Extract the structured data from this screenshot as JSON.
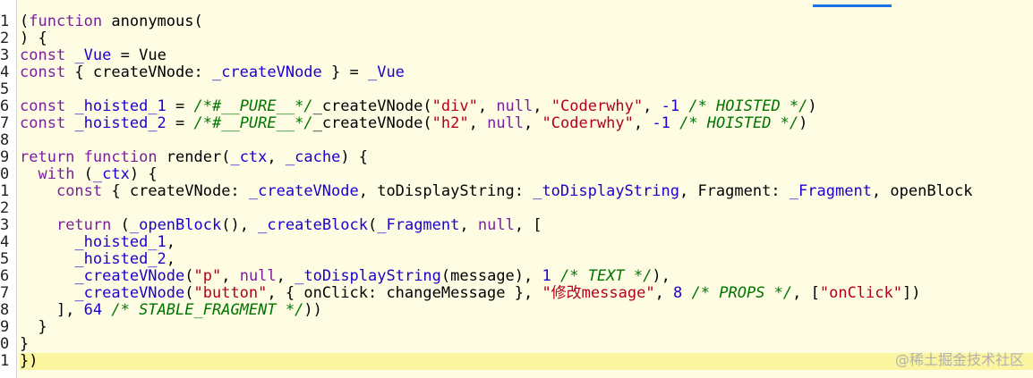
{
  "gutter_numbers": [
    "1",
    "2",
    "3",
    "4",
    "5",
    "6",
    "7",
    "8",
    "9",
    "0",
    "1",
    "2",
    "3",
    "4",
    "5",
    "6",
    "7",
    "8",
    "9",
    "0",
    "1"
  ],
  "code_lines": [
    [
      {
        "t": "(",
        "c": "plain"
      },
      {
        "t": "function",
        "c": "kw"
      },
      {
        "t": " anonymous(",
        "c": "plain"
      }
    ],
    [
      {
        "t": ") {",
        "c": "plain"
      }
    ],
    [
      {
        "t": "const",
        "c": "kw"
      },
      {
        "t": " ",
        "c": "plain"
      },
      {
        "t": "_Vue",
        "c": "var"
      },
      {
        "t": " = Vue",
        "c": "plain"
      }
    ],
    [
      {
        "t": "const",
        "c": "kw"
      },
      {
        "t": " { createVNode: ",
        "c": "plain"
      },
      {
        "t": "_createVNode",
        "c": "var"
      },
      {
        "t": " } = ",
        "c": "plain"
      },
      {
        "t": "_Vue",
        "c": "var"
      }
    ],
    [],
    [
      {
        "t": "const",
        "c": "kw"
      },
      {
        "t": " ",
        "c": "plain"
      },
      {
        "t": "_hoisted_1",
        "c": "var"
      },
      {
        "t": " = ",
        "c": "plain"
      },
      {
        "t": "/*#__PURE__*/",
        "c": "comment"
      },
      {
        "t": "_createVNode(",
        "c": "plain"
      },
      {
        "t": "\"div\"",
        "c": "str"
      },
      {
        "t": ", ",
        "c": "plain"
      },
      {
        "t": "null",
        "c": "kw"
      },
      {
        "t": ", ",
        "c": "plain"
      },
      {
        "t": "\"Coderwhy\"",
        "c": "str"
      },
      {
        "t": ", ",
        "c": "plain"
      },
      {
        "t": "-1",
        "c": "num"
      },
      {
        "t": " ",
        "c": "plain"
      },
      {
        "t": "/* HOISTED */",
        "c": "comment"
      },
      {
        "t": ")",
        "c": "plain"
      }
    ],
    [
      {
        "t": "const",
        "c": "kw"
      },
      {
        "t": " ",
        "c": "plain"
      },
      {
        "t": "_hoisted_2",
        "c": "var"
      },
      {
        "t": " = ",
        "c": "plain"
      },
      {
        "t": "/*#__PURE__*/",
        "c": "comment"
      },
      {
        "t": "_createVNode(",
        "c": "plain"
      },
      {
        "t": "\"h2\"",
        "c": "str"
      },
      {
        "t": ", ",
        "c": "plain"
      },
      {
        "t": "null",
        "c": "kw"
      },
      {
        "t": ", ",
        "c": "plain"
      },
      {
        "t": "\"Coderwhy\"",
        "c": "str"
      },
      {
        "t": ", ",
        "c": "plain"
      },
      {
        "t": "-1",
        "c": "num"
      },
      {
        "t": " ",
        "c": "plain"
      },
      {
        "t": "/* HOISTED */",
        "c": "comment"
      },
      {
        "t": ")",
        "c": "plain"
      }
    ],
    [],
    [
      {
        "t": "return",
        "c": "kw"
      },
      {
        "t": " ",
        "c": "plain"
      },
      {
        "t": "function",
        "c": "kw"
      },
      {
        "t": " render(",
        "c": "plain"
      },
      {
        "t": "_ctx",
        "c": "var"
      },
      {
        "t": ", ",
        "c": "plain"
      },
      {
        "t": "_cache",
        "c": "var"
      },
      {
        "t": ") {",
        "c": "plain"
      }
    ],
    [
      {
        "t": "  ",
        "c": "plain"
      },
      {
        "t": "with",
        "c": "kw"
      },
      {
        "t": " (",
        "c": "plain"
      },
      {
        "t": "_ctx",
        "c": "var"
      },
      {
        "t": ") {",
        "c": "plain"
      }
    ],
    [
      {
        "t": "    ",
        "c": "plain"
      },
      {
        "t": "const",
        "c": "kw"
      },
      {
        "t": " { createVNode: ",
        "c": "plain"
      },
      {
        "t": "_createVNode",
        "c": "var"
      },
      {
        "t": ", toDisplayString: ",
        "c": "plain"
      },
      {
        "t": "_toDisplayString",
        "c": "var"
      },
      {
        "t": ", Fragment: ",
        "c": "plain"
      },
      {
        "t": "_Fragment",
        "c": "var"
      },
      {
        "t": ", openBlock",
        "c": "plain"
      }
    ],
    [],
    [
      {
        "t": "    ",
        "c": "plain"
      },
      {
        "t": "return",
        "c": "kw"
      },
      {
        "t": " (",
        "c": "plain"
      },
      {
        "t": "_openBlock",
        "c": "var"
      },
      {
        "t": "(), ",
        "c": "plain"
      },
      {
        "t": "_createBlock",
        "c": "var"
      },
      {
        "t": "(",
        "c": "plain"
      },
      {
        "t": "_Fragment",
        "c": "var"
      },
      {
        "t": ", ",
        "c": "plain"
      },
      {
        "t": "null",
        "c": "kw"
      },
      {
        "t": ", [",
        "c": "plain"
      }
    ],
    [
      {
        "t": "      ",
        "c": "plain"
      },
      {
        "t": "_hoisted_1",
        "c": "var"
      },
      {
        "t": ",",
        "c": "plain"
      }
    ],
    [
      {
        "t": "      ",
        "c": "plain"
      },
      {
        "t": "_hoisted_2",
        "c": "var"
      },
      {
        "t": ",",
        "c": "plain"
      }
    ],
    [
      {
        "t": "      ",
        "c": "plain"
      },
      {
        "t": "_createVNode",
        "c": "var"
      },
      {
        "t": "(",
        "c": "plain"
      },
      {
        "t": "\"p\"",
        "c": "str"
      },
      {
        "t": ", ",
        "c": "plain"
      },
      {
        "t": "null",
        "c": "kw"
      },
      {
        "t": ", ",
        "c": "plain"
      },
      {
        "t": "_toDisplayString",
        "c": "var"
      },
      {
        "t": "(message), ",
        "c": "plain"
      },
      {
        "t": "1",
        "c": "num"
      },
      {
        "t": " ",
        "c": "plain"
      },
      {
        "t": "/* TEXT */",
        "c": "comment"
      },
      {
        "t": "),",
        "c": "plain"
      }
    ],
    [
      {
        "t": "      ",
        "c": "plain"
      },
      {
        "t": "_createVNode",
        "c": "var"
      },
      {
        "t": "(",
        "c": "plain"
      },
      {
        "t": "\"button\"",
        "c": "str"
      },
      {
        "t": ", { onClick: changeMessage }, ",
        "c": "plain"
      },
      {
        "t": "\"修改message\"",
        "c": "str"
      },
      {
        "t": ", ",
        "c": "plain"
      },
      {
        "t": "8",
        "c": "num"
      },
      {
        "t": " ",
        "c": "plain"
      },
      {
        "t": "/* PROPS */",
        "c": "comment"
      },
      {
        "t": ", [",
        "c": "plain"
      },
      {
        "t": "\"onClick\"",
        "c": "str"
      },
      {
        "t": "])",
        "c": "plain"
      }
    ],
    [
      {
        "t": "    ], ",
        "c": "plain"
      },
      {
        "t": "64",
        "c": "num"
      },
      {
        "t": " ",
        "c": "plain"
      },
      {
        "t": "/* STABLE_FRAGMENT */",
        "c": "comment"
      },
      {
        "t": "))",
        "c": "plain"
      }
    ],
    [
      {
        "t": "  }",
        "c": "plain"
      }
    ],
    [
      {
        "t": "}",
        "c": "plain"
      }
    ],
    [
      {
        "t": "})",
        "c": "plain"
      }
    ]
  ],
  "active_line_index": 20,
  "watermark": "@稀土掘金技术社区",
  "colors": {
    "background": "#fefde4",
    "active_line": "#fbf4a0",
    "keyword": "#7a1f9e",
    "identifier": "#1c00cf",
    "string": "#b4001a",
    "comment": "#007400"
  }
}
